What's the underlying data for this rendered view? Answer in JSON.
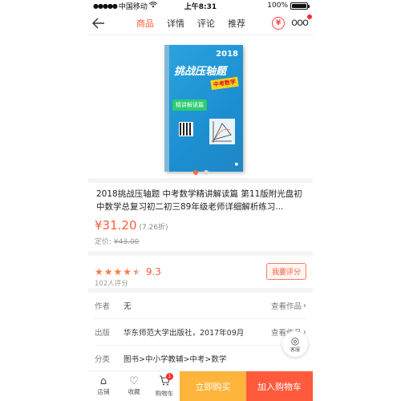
{
  "status_bar": {
    "carrier": "中国移动",
    "time": "上午8:31",
    "battery": "100%"
  },
  "nav": {
    "tabs": [
      {
        "label": "商品",
        "active": true
      },
      {
        "label": "详情",
        "active": false
      },
      {
        "label": "评论",
        "active": false
      },
      {
        "label": "推荐",
        "active": false
      }
    ],
    "coin_icon": "¥"
  },
  "cover": {
    "year": "2018",
    "title": "挑战压轴题",
    "subtitle": "中考数学",
    "ribbon": "精讲解读篇"
  },
  "gallery": {
    "slides": 2,
    "active_index": 0
  },
  "product": {
    "title": "2018挑战压轴题 中考数学精讲解读篇 第11版附光盘初中数学总复习初二初三89年级老师详细解析练习...",
    "price": "¥31.20",
    "discount": "(7.26折)",
    "list_price_label": "定价:",
    "list_price": "¥43.00"
  },
  "rating": {
    "score": "9.3",
    "stars": 4.5,
    "count_text": "102人评分",
    "rate_button": "我要评分"
  },
  "details": [
    {
      "key": "作者",
      "value": "无",
      "more": "查看作品"
    },
    {
      "key": "出版",
      "value": "华东师范大学出版社，2017年09月",
      "more": "查看作品"
    },
    {
      "key": "分类",
      "value": "图书>中小学教辅>中考>数学",
      "more": ""
    }
  ],
  "service": {
    "label": "客服"
  },
  "bottom_bar": {
    "shop": "店铺",
    "favorite": "收藏",
    "cart": "购物车",
    "cart_count": "1",
    "buy_now": "立即购买",
    "add_to_cart": "加入购物车"
  },
  "colors": {
    "accent": "#ff5a3c",
    "buy_now": "#ffb43b",
    "add_to_cart": "#ff5a3c"
  }
}
